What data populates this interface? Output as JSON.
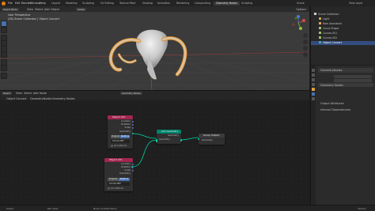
{
  "menu": [
    "File",
    "Edit",
    "Render",
    "Window",
    "Help"
  ],
  "workspace_tabs": [
    "Layout",
    "Modeling",
    "Sculpting",
    "UV Editing",
    "Texture Paint",
    "Shading",
    "Animation",
    "Rendering",
    "Compositing",
    "Geometry Nodes",
    "Scripting"
  ],
  "active_tab": "Geometry Nodes",
  "header_right": {
    "scene": "Scene",
    "view_layer": "View Layer"
  },
  "viewport": {
    "mode": "Object Mode",
    "menus": [
      "View",
      "Select",
      "Add",
      "Object"
    ],
    "transform": "Global",
    "info_line1": "User Perspective",
    "info_line2": "(26) Scene Collection | Object Convert",
    "options": "Options"
  },
  "outliner": {
    "title": "Scene Collection",
    "rows": [
      "Scene Collection",
      "Light",
      "Ram Animated",
      "Curve Shape",
      "Curves.001",
      "Curves.002",
      "Object Convert"
    ],
    "selected_index": 6
  },
  "properties": {
    "modifier_name": "GeometryNodes",
    "group": "Geometry Nodes",
    "sections": [
      "Output Attributes",
      "Internal Dependencies"
    ]
  },
  "node_editor": {
    "mode": "Object",
    "menus": [
      "View",
      "Select",
      "Add",
      "Node"
    ],
    "breadcrumb": [
      "Object Convert",
      "GeometryNodes",
      "Geometry Nodes"
    ],
    "node_tree": "Geometry Nodes"
  },
  "nodes": {
    "oi1": {
      "title": "Object Info",
      "outputs": [
        "Location",
        "Rotation",
        "Scale",
        "Geometry"
      ],
      "toggle_a": "Original",
      "toggle_b": "Relative",
      "toggle_active": "Relative",
      "object_value": "Curves.001",
      "checkbox": "As Instance"
    },
    "oi2": {
      "title": "Object Info",
      "outputs": [
        "Location",
        "Rotation",
        "Scale",
        "Geometry"
      ],
      "toggle_a": "Original",
      "toggle_b": "Relative",
      "toggle_active": "Relative",
      "object_value": "Curves.002",
      "checkbox": "As Instance"
    },
    "join": {
      "title": "Join Geometry",
      "socket": "Geometry"
    },
    "out": {
      "title": "Group Output",
      "socket": "Geometry"
    }
  },
  "statusbar": [
    "Select",
    "Pan View",
    "Node Context Menu",
    "Version"
  ]
}
